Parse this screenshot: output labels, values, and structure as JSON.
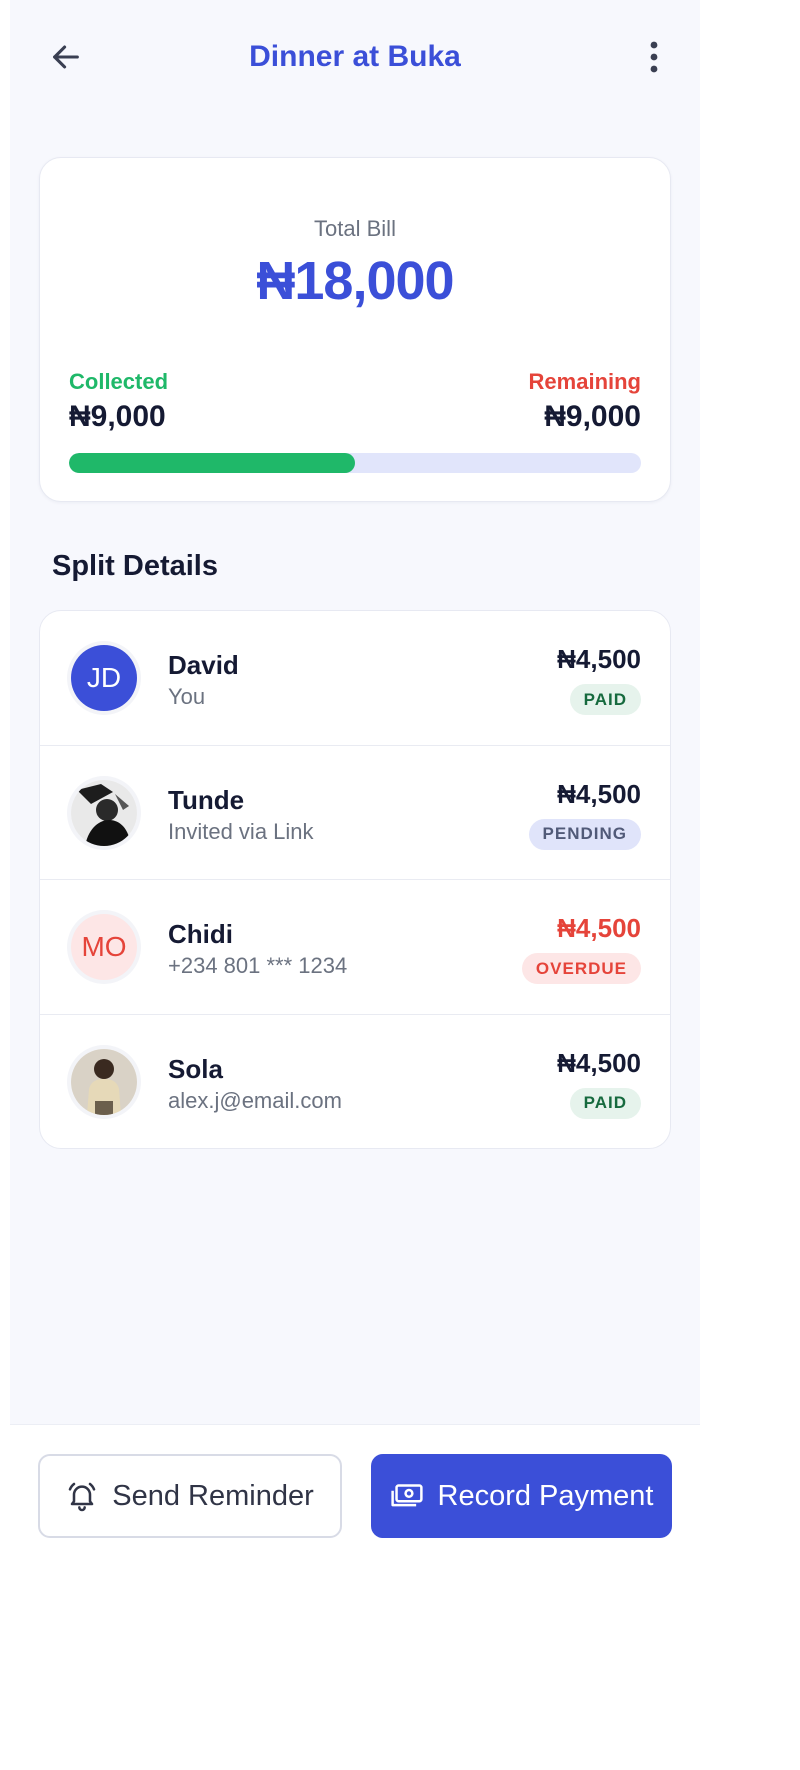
{
  "header": {
    "title": "Dinner at Buka",
    "back_icon": "arrow-left-icon",
    "more_icon": "more-vertical-icon"
  },
  "summary": {
    "total_label": "Total Bill",
    "total_amount": "₦18,000",
    "collected_label": "Collected",
    "collected_amount": "₦9,000",
    "remaining_label": "Remaining",
    "remaining_amount": "₦9,000",
    "progress_fraction": 0.5
  },
  "section_title": "Split Details",
  "participants": [
    {
      "name": "David",
      "sub": "You",
      "avatar_initials": "JD",
      "amount": "₦4,500",
      "status": "PAID"
    },
    {
      "name": "Tunde",
      "sub": "Invited via Link",
      "avatar_icon": "person-photo-icon",
      "amount": "₦4,500",
      "status": "PENDING"
    },
    {
      "name": "Chidi",
      "sub": "+234 801 *** 1234",
      "avatar_initials": "MO",
      "amount": "₦4,500",
      "status": "OVERDUE"
    },
    {
      "name": "Sola",
      "sub": "alex.j@email.com",
      "avatar_icon": "person-photo-icon",
      "amount": "₦4,500",
      "status": "PAID"
    }
  ],
  "actions": {
    "send_reminder_label": "Send Reminder",
    "send_reminder_icon": "bell-icon",
    "record_payment_label": "Record Payment",
    "record_payment_icon": "cash-icon"
  },
  "colors": {
    "accent": "#3b4fd8",
    "success": "#1fb869",
    "danger": "#e5443a",
    "track": "#e1e5fb"
  }
}
